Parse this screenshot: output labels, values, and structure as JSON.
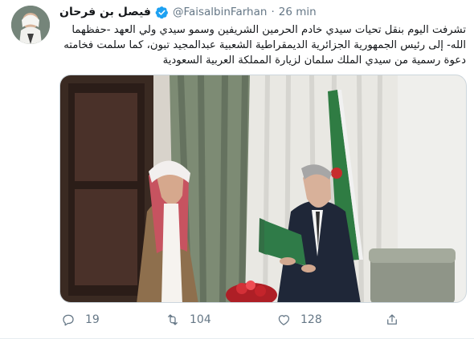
{
  "tweet": {
    "author_name": "فيصل بن فرحان",
    "handle": "@FaisalbinFarhan",
    "separator": "·",
    "time": "26 min",
    "text": "تشرفت اليوم بنقل تحيات سيدي خادم الحرمين الشريفين وسمو سيدي ولي العهد -حفظهما الله- إلى رئيس الجمهورية الجزائرية الديمقراطية الشعبية عبدالمجيد تبون، كما سلمت فخامته دعوة رسمية من سيدي الملك سلمان لزيارة المملكة العربية السعودية",
    "reply_count": "19",
    "retweet_count": "104",
    "like_count": "128"
  },
  "icons": {
    "avatar": "avatar-photo",
    "verified": "verified-badge-icon",
    "reply": "reply-icon",
    "retweet": "retweet-icon",
    "like": "heart-icon",
    "share": "share-icon"
  },
  "colors": {
    "verified": "#1da1f2",
    "secondary_text": "#657786",
    "border": "#e6ecf0"
  }
}
